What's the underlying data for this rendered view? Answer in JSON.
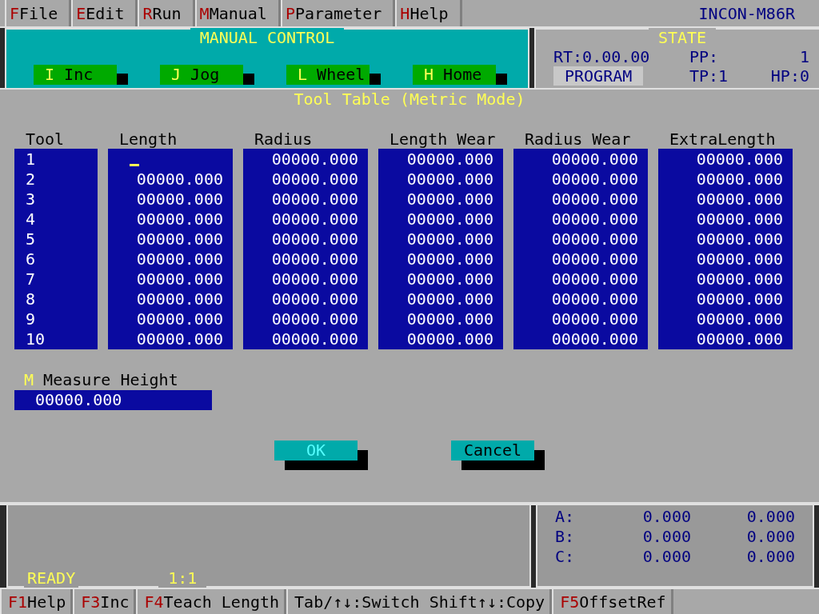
{
  "menu": [
    {
      "key": "F",
      "label": "File"
    },
    {
      "key": "E",
      "label": "Edit"
    },
    {
      "key": "R",
      "label": "Run"
    },
    {
      "key": "M",
      "label": "Manual"
    },
    {
      "key": "P",
      "label": "Parameter"
    },
    {
      "key": "H",
      "label": "Help"
    }
  ],
  "product": "INCON-M86R",
  "manual_control": {
    "title": "MANUAL CONTROL",
    "modes": [
      {
        "key": "I",
        "label": "Inc"
      },
      {
        "key": "J",
        "label": "Jog"
      },
      {
        "key": "L",
        "label": "Wheel"
      },
      {
        "key": "H",
        "label": "Home"
      }
    ]
  },
  "state": {
    "title": "STATE",
    "rt": "RT:0.00.00",
    "pp_label": "PP:",
    "pp": "1",
    "mode": "PROGRAM",
    "tp": "TP:1",
    "hp": "HP:0"
  },
  "dialog": {
    "title": "Tool Table (Metric Mode)",
    "columns": [
      "Tool",
      "Length",
      "Radius",
      "Length Wear",
      "Radius Wear",
      "ExtraLength"
    ],
    "rows": [
      {
        "tool": "1",
        "editing": true,
        "values": [
          "00000.000",
          "00000.000",
          "00000.000",
          "00000.000"
        ]
      },
      {
        "tool": "2",
        "editing": false,
        "length": "00000.000",
        "values": [
          "00000.000",
          "00000.000",
          "00000.000",
          "00000.000"
        ]
      },
      {
        "tool": "3",
        "editing": false,
        "length": "00000.000",
        "values": [
          "00000.000",
          "00000.000",
          "00000.000",
          "00000.000"
        ]
      },
      {
        "tool": "4",
        "editing": false,
        "length": "00000.000",
        "values": [
          "00000.000",
          "00000.000",
          "00000.000",
          "00000.000"
        ]
      },
      {
        "tool": "5",
        "editing": false,
        "length": "00000.000",
        "values": [
          "00000.000",
          "00000.000",
          "00000.000",
          "00000.000"
        ]
      },
      {
        "tool": "6",
        "editing": false,
        "length": "00000.000",
        "values": [
          "00000.000",
          "00000.000",
          "00000.000",
          "00000.000"
        ]
      },
      {
        "tool": "7",
        "editing": false,
        "length": "00000.000",
        "values": [
          "00000.000",
          "00000.000",
          "00000.000",
          "00000.000"
        ]
      },
      {
        "tool": "8",
        "editing": false,
        "length": "00000.000",
        "values": [
          "00000.000",
          "00000.000",
          "00000.000",
          "00000.000"
        ]
      },
      {
        "tool": "9",
        "editing": false,
        "length": "00000.000",
        "values": [
          "00000.000",
          "00000.000",
          "00000.000",
          "00000.000"
        ]
      },
      {
        "tool": "10",
        "editing": false,
        "length": "00000.000",
        "values": [
          "00000.000",
          "00000.000",
          "00000.000",
          "00000.000"
        ]
      }
    ],
    "measure": {
      "key": "M",
      "label": "Measure Height",
      "value": "00000.000"
    },
    "buttons": [
      "OK",
      "Cancel"
    ]
  },
  "status": {
    "message": "READY",
    "ratio": "1:1"
  },
  "axes": [
    {
      "name": "A:",
      "value_1": "0.000",
      "value_2": "0.000"
    },
    {
      "name": "B:",
      "value_1": "0.000",
      "value_2": "0.000"
    },
    {
      "name": "C:",
      "value_1": "0.000",
      "value_2": "0.000"
    }
  ],
  "function_keys": [
    {
      "key": "F1",
      "label": "Help"
    },
    {
      "key": "F3",
      "label": "Inc"
    },
    {
      "key": "F4",
      "label": "Teach Length"
    },
    {
      "label": "Tab/↑↓:Switch Shift↑↓:Copy"
    },
    {
      "key": "F5",
      "label": "OffsetRef"
    }
  ]
}
